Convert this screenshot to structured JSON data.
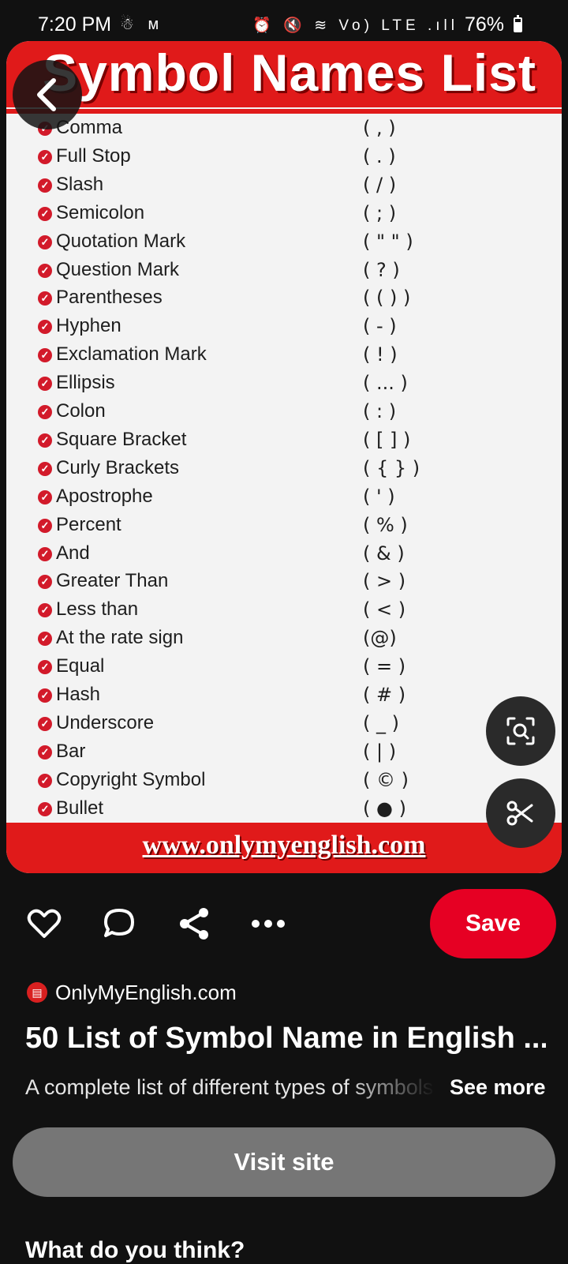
{
  "status_bar": {
    "time": "7:20 PM",
    "left_icons": "☃ ᴍ",
    "right_icons": "⏰ 🔇 ≋ Vo) LTE .ıll",
    "battery": "76%"
  },
  "pin": {
    "title": "Symbol Names List",
    "footer_url": "www.onlymyenglish.com",
    "symbols": [
      {
        "name": "Comma",
        "symbol": "( , )"
      },
      {
        "name": "Full Stop",
        "symbol": "( . )"
      },
      {
        "name": "Slash",
        "symbol": "( / )"
      },
      {
        "name": "Semicolon",
        "symbol": "( ; )"
      },
      {
        "name": "Quotation Mark",
        "symbol": "( \" \" )"
      },
      {
        "name": "Question Mark",
        "symbol": "( ? )"
      },
      {
        "name": "Parentheses",
        "symbol": "( ( ) )"
      },
      {
        "name": "Hyphen",
        "symbol": "( - )"
      },
      {
        "name": "Exclamation Mark",
        "symbol": "( ! )"
      },
      {
        "name": "Ellipsis",
        "symbol": "( ... )"
      },
      {
        "name": "Colon",
        "symbol": "( : )"
      },
      {
        "name": "Square Bracket",
        "symbol": "( [ ] )"
      },
      {
        "name": "Curly Brackets",
        "symbol": "( { } )"
      },
      {
        "name": "Apostrophe",
        "symbol": "( ' )"
      },
      {
        "name": "Percent",
        "symbol": "( % )"
      },
      {
        "name": "And",
        "symbol": "( & )"
      },
      {
        "name": "Greater Than",
        "symbol": "( > )"
      },
      {
        "name": "Less than",
        "symbol": "( < )"
      },
      {
        "name": "At the rate sign",
        "symbol": "(@)"
      },
      {
        "name": "Equal",
        "symbol": "( = )"
      },
      {
        "name": "Hash",
        "symbol": "( # )"
      },
      {
        "name": "Underscore",
        "symbol": "( _ )"
      },
      {
        "name": "Bar",
        "symbol": "( | )"
      },
      {
        "name": "Copyright Symbol",
        "symbol": "( © )"
      },
      {
        "name": "Bullet",
        "symbol": "( ● )"
      }
    ]
  },
  "actions": {
    "save_label": "Save"
  },
  "source": {
    "name": "OnlyMyEnglish.com"
  },
  "details": {
    "heading": "50 List of Symbol Name in English ...",
    "description": "A complete list of different types of symbols",
    "see_more": "See more",
    "visit_label": "Visit site",
    "feedback_title": "What do you think?"
  },
  "colors": {
    "accent": "#e60023",
    "background": "#111111",
    "pin_red": "#e01a1a"
  }
}
